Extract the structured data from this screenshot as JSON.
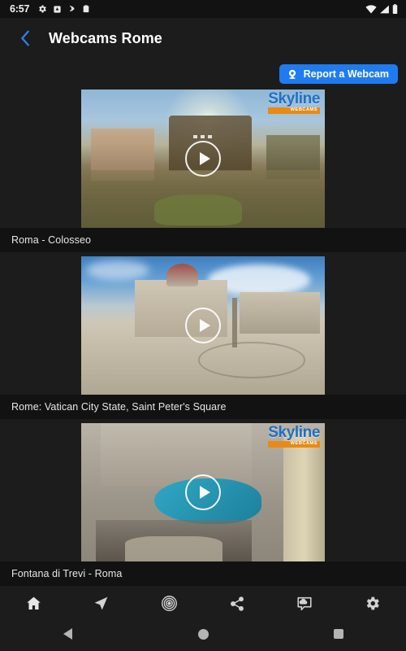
{
  "statusbar": {
    "time": "6:57",
    "left_icons": [
      "gear-icon",
      "alarm-icon",
      "bluetooth-share-icon",
      "clipboard-icon"
    ],
    "right_icons": [
      "wifi-icon",
      "cellular-signal-icon",
      "battery-icon"
    ]
  },
  "appbar": {
    "back_icon": "chevron-left-icon",
    "title": "Webcams Rome"
  },
  "report": {
    "icon": "webcam-icon",
    "label": "Report a Webcam",
    "accent_color": "#1f7bf0"
  },
  "watermark": {
    "main": "Skyline",
    "sub": "WEBCAMS",
    "main_color": "#1f6fc4",
    "sub_color": "#e98a14"
  },
  "webcams": [
    {
      "label": "Roma - Colosseo",
      "thumb_class": "thumb-colosseo",
      "has_watermark": true,
      "has_dots": true,
      "play_icon": "play-icon"
    },
    {
      "label": "Rome: Vatican City State, Saint Peter's Square",
      "thumb_class": "thumb-vatican",
      "has_watermark": false,
      "has_dots": false,
      "play_icon": "play-icon"
    },
    {
      "label": "Fontana di Trevi - Roma",
      "thumb_class": "thumb-trevi",
      "has_watermark": true,
      "has_dots": false,
      "play_icon": "play-icon"
    }
  ],
  "bottomnav": {
    "items": [
      {
        "icon": "home-icon",
        "name": "nav-home"
      },
      {
        "icon": "navigation-arrow-icon",
        "name": "nav-nearby"
      },
      {
        "icon": "radar-icon",
        "name": "nav-radar"
      },
      {
        "icon": "share-icon",
        "name": "nav-share"
      },
      {
        "icon": "weather-cloud-icon",
        "name": "nav-weather"
      },
      {
        "icon": "gear-icon",
        "name": "nav-settings"
      }
    ]
  },
  "sysnav": {
    "back": "triangle-back-icon",
    "home": "circle-home-icon",
    "recents": "square-recents-icon"
  }
}
